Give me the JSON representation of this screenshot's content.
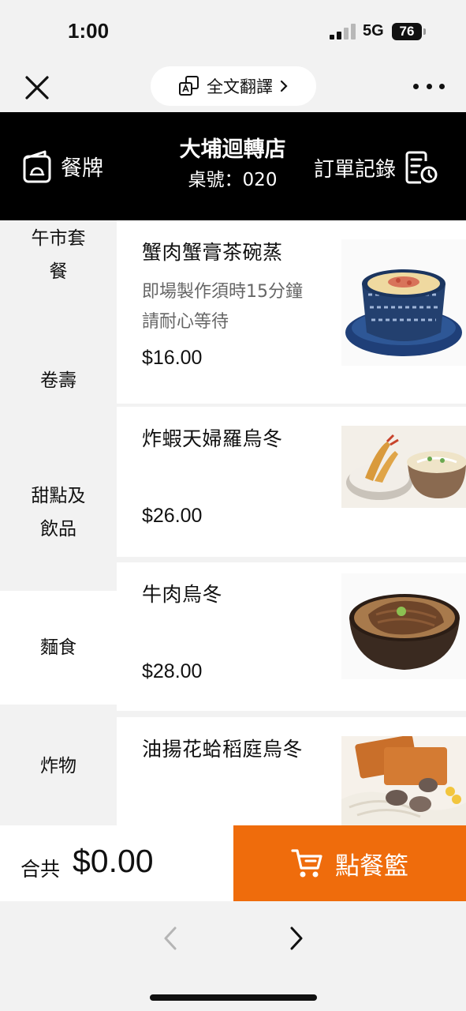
{
  "status_bar": {
    "time": "1:00",
    "network": "5G",
    "battery": "76"
  },
  "nav": {
    "translate_label": "全文翻譯"
  },
  "header": {
    "menu_label": "餐牌",
    "store_name": "大埔迴轉店",
    "table_label": "桌號：020",
    "orders_label": "訂單記錄"
  },
  "categories": [
    {
      "line1": "午市套",
      "line2": "餐"
    },
    {
      "line1": "卷壽",
      "line2": ""
    },
    {
      "line1": "甜點及",
      "line2": "飲品"
    },
    {
      "line1": "麵食",
      "line2": ""
    },
    {
      "line1": "炸物",
      "line2": ""
    }
  ],
  "items": [
    {
      "name": "蟹肉蟹膏茶碗蒸",
      "desc": "即場製作須時15分鐘 請耐心等待",
      "price": "$16.00"
    },
    {
      "name": "炸蝦天婦羅烏冬",
      "desc": "",
      "price": "$26.00"
    },
    {
      "name": "牛肉烏冬",
      "desc": "",
      "price": "$28.00"
    },
    {
      "name": "油揚花蛤稻庭烏冬",
      "desc": "",
      "price": ""
    }
  ],
  "footer": {
    "total_label": "合共",
    "total_value": "$0.00",
    "cart_label": "點餐籃"
  },
  "colors": {
    "accent": "#ef6c0c",
    "header_bg": "#000000",
    "background": "#f2f2f2"
  }
}
